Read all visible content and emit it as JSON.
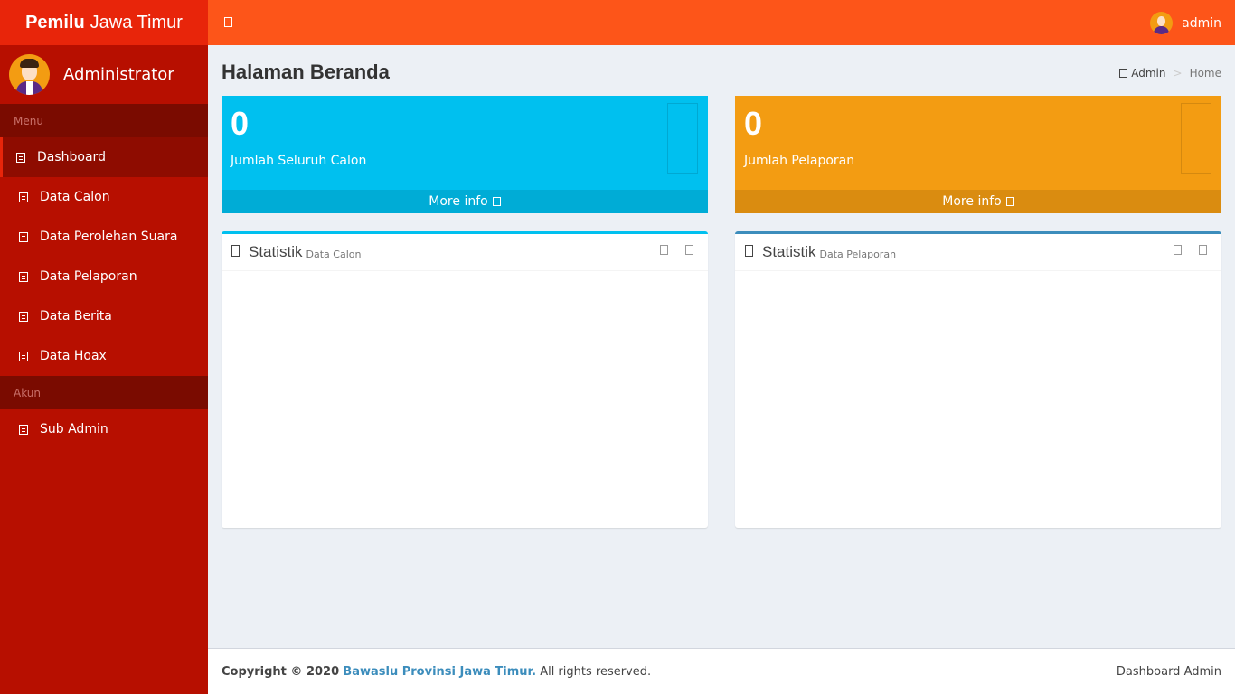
{
  "brand": {
    "bold": "Pemilu",
    "rest": "Jawa Timur"
  },
  "sidebar": {
    "user_name": "Administrator",
    "sections": [
      {
        "header": "Menu",
        "items": [
          {
            "label": "Dashboard",
            "active": true
          },
          {
            "label": "Data Calon"
          },
          {
            "label": "Data Perolehan Suara"
          },
          {
            "label": "Data Pelaporan"
          },
          {
            "label": "Data Berita"
          },
          {
            "label": "Data Hoax"
          }
        ]
      },
      {
        "header": "Akun",
        "items": [
          {
            "label": "Sub Admin"
          }
        ]
      }
    ]
  },
  "topbar": {
    "username": "admin"
  },
  "page": {
    "title": "Halaman Beranda",
    "breadcrumb": {
      "root": "Admin",
      "separator": ">",
      "current": "Home"
    }
  },
  "stats": {
    "calon": {
      "value": "0",
      "label": "Jumlah Seluruh Calon",
      "more": "More info",
      "color": "#00c0ef"
    },
    "pelaporan": {
      "value": "0",
      "label": "Jumlah Pelaporan",
      "more": "More info",
      "color": "#f39c12"
    }
  },
  "panels": {
    "calon": {
      "title": "Statistik",
      "subtitle": "Data Calon"
    },
    "pelaporan": {
      "title": "Statistik",
      "subtitle": "Data Pelaporan"
    }
  },
  "footer": {
    "copyright": "Copyright © 2020",
    "org": "Bawaslu Provinsi Jawa Timur.",
    "rights": "All rights reserved.",
    "right_text": "Dashboard Admin"
  },
  "colors": {
    "sidebar": "#b70f00",
    "header": "#fd5519",
    "logo": "#e8250a",
    "aqua": "#00c0ef",
    "yellow": "#f39c12",
    "link": "#3c8dbc"
  }
}
